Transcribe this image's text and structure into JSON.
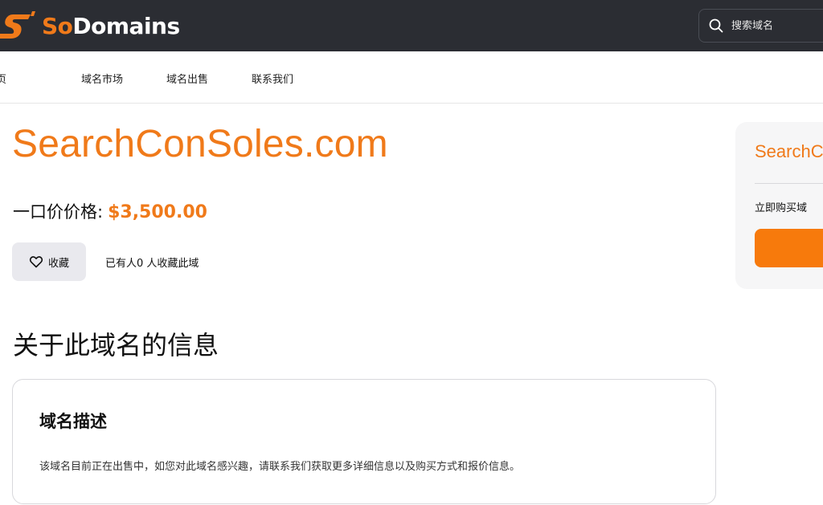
{
  "header": {
    "brand_so": "So",
    "brand_domains": "Domains",
    "search_placeholder": "搜索域名",
    "accent_color": "#f07a1a",
    "background_color": "#2b2d33"
  },
  "nav": {
    "items": [
      {
        "label": "首页"
      },
      {
        "label": "域名市场"
      },
      {
        "label": "域名出售"
      },
      {
        "label": "联系我们"
      }
    ]
  },
  "main": {
    "domain_name": "SearchConSoles.com",
    "price_label": "一口价价格:",
    "price_value": "$3,500.00",
    "favorite_label": "收藏",
    "favorite_count_text": "已有人0 人收藏此域",
    "section_heading": "关于此域名的信息",
    "info_card": {
      "title": "域名描述",
      "text": "该域名目前正在出售中，如您对此域名感兴趣，请联系我们获取更多详细信息以及购买方式和报价信息。"
    }
  },
  "side_panel": {
    "title": "SearchConSoles.com",
    "label": "立即购买域",
    "button_color": "#f77a0c"
  }
}
